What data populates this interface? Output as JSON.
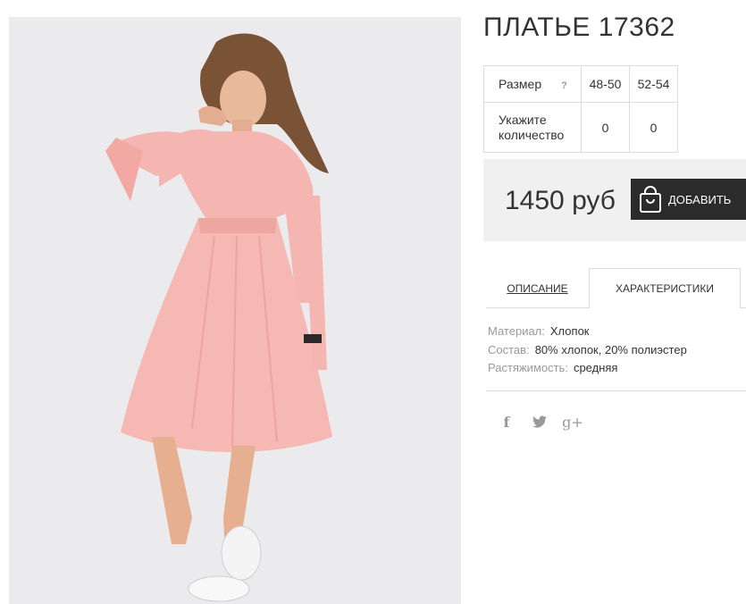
{
  "product": {
    "title": "ПЛАТЬЕ 17362",
    "image_alt": "pink-dress-photo"
  },
  "size_table": {
    "size_label": "Размер",
    "help_mark": "?",
    "sizes": [
      "48-50",
      "52-54"
    ],
    "quantity_label": "Укажите количество",
    "quantities": [
      "0",
      "0"
    ]
  },
  "purchase": {
    "price": "1450 руб",
    "cart_button_label": "ДОБАВИТЬ",
    "cart_icon": "shopping-bag-icon"
  },
  "tabs": [
    {
      "label": "ОПИСАНИЕ",
      "active": false
    },
    {
      "label": "ХАРАКТЕРИСТИКИ",
      "active": true
    }
  ],
  "specs": [
    {
      "key": "Материал:",
      "value": "Хлопок"
    },
    {
      "key": "Состав:",
      "value": "80% хлопок, 20% полиэстер"
    },
    {
      "key": "Растяжимость:",
      "value": "средняя"
    }
  ],
  "social": {
    "facebook": "f",
    "twitter": "twitter-bird",
    "google_plus": "g+"
  },
  "colors": {
    "dark_button": "#2b2b2b",
    "price_panel_bg": "#f0f0f0",
    "border": "#dcdcdc",
    "dress_pink": "#f7b9b5"
  }
}
